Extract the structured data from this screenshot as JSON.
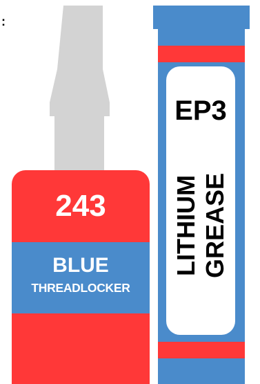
{
  "corner_mark": ":",
  "threadlocker": {
    "number": "243",
    "color_name": "BLUE",
    "type": "THREADLOCKER",
    "colors": {
      "red": "#ff3838",
      "blue": "#4a8bcb",
      "cap": "#d3d3d3"
    }
  },
  "grease_tube": {
    "grade": "EP3",
    "line1": "LITHIUM",
    "line2": "GREASE",
    "colors": {
      "blue": "#4a8bcb",
      "red": "#ff3838",
      "label": "#ffffff"
    }
  }
}
